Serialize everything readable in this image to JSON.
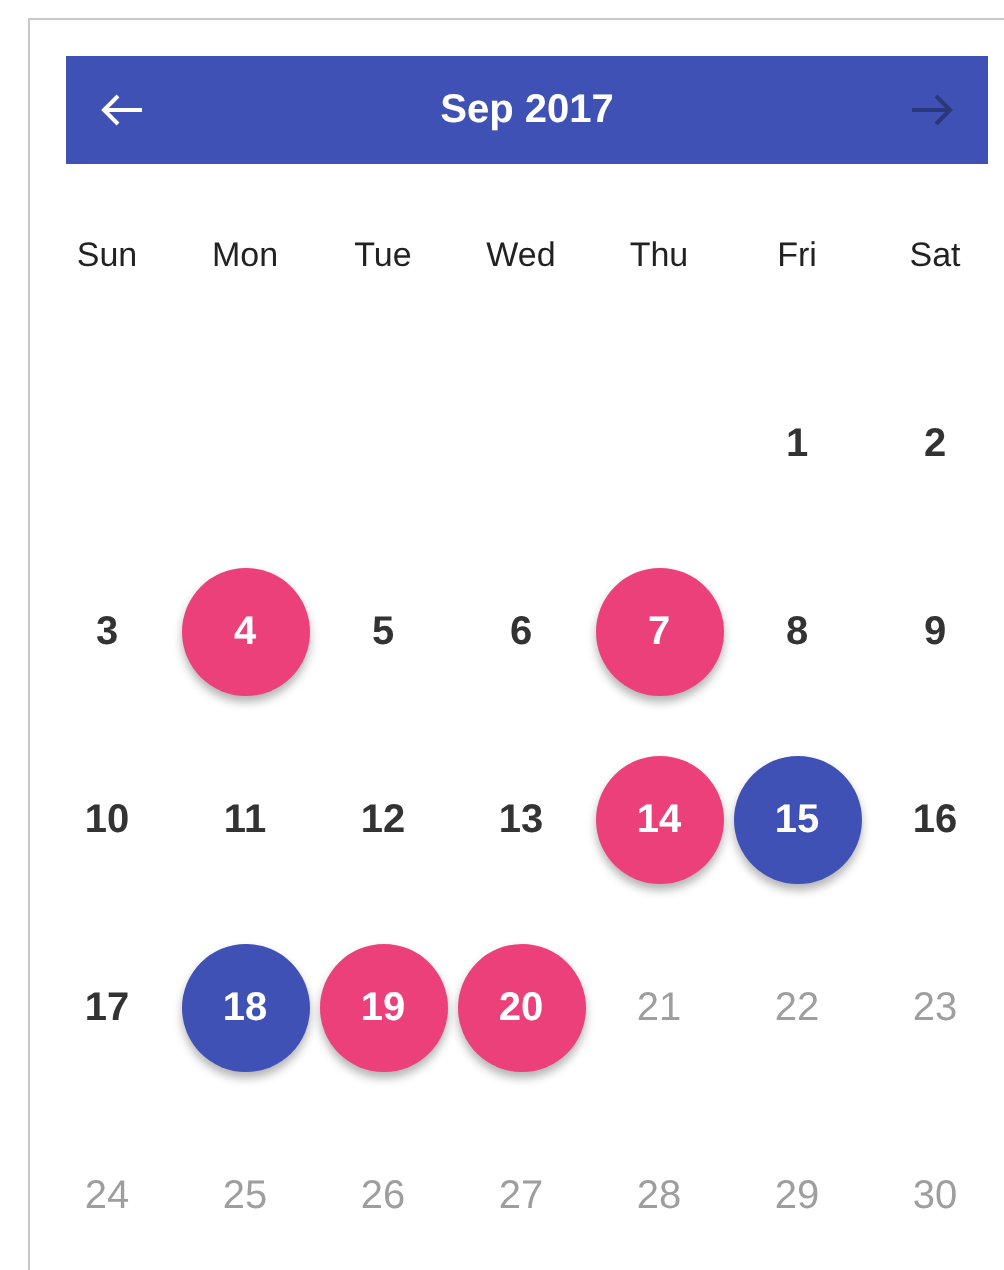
{
  "header": {
    "title": "Sep 2017",
    "prev": {
      "disabled": false
    },
    "next": {
      "disabled": true
    }
  },
  "weekdays": [
    "Sun",
    "Mon",
    "Tue",
    "Wed",
    "Thu",
    "Fri",
    "Sat"
  ],
  "weeks": [
    [
      {
        "label": "1",
        "disabled": false
      },
      {
        "label": "2",
        "disabled": false
      }
    ],
    [
      {
        "label": "3",
        "disabled": false
      },
      {
        "label": "4",
        "disabled": false,
        "color": "#ec407a"
      },
      {
        "label": "5",
        "disabled": false
      },
      {
        "label": "6",
        "disabled": false
      },
      {
        "label": "7",
        "disabled": false,
        "color": "#ec407a"
      },
      {
        "label": "8",
        "disabled": false
      },
      {
        "label": "9",
        "disabled": false
      }
    ],
    [
      {
        "label": "10",
        "disabled": false
      },
      {
        "label": "11",
        "disabled": false
      },
      {
        "label": "12",
        "disabled": false
      },
      {
        "label": "13",
        "disabled": false
      },
      {
        "label": "14",
        "disabled": false,
        "color": "#ec407a"
      },
      {
        "label": "15",
        "disabled": false,
        "color": "#3f51b5"
      },
      {
        "label": "16",
        "disabled": false
      }
    ],
    [
      {
        "label": "17",
        "disabled": false
      },
      {
        "label": "18",
        "disabled": false,
        "color": "#3f51b5"
      },
      {
        "label": "19",
        "disabled": false,
        "color": "#ec407a"
      },
      {
        "label": "20",
        "disabled": false,
        "color": "#ec407a"
      },
      {
        "label": "21",
        "disabled": true
      },
      {
        "label": "22",
        "disabled": true
      },
      {
        "label": "23",
        "disabled": true
      }
    ],
    [
      {
        "label": "24",
        "disabled": true
      },
      {
        "label": "25",
        "disabled": true
      },
      {
        "label": "26",
        "disabled": true
      },
      {
        "label": "27",
        "disabled": true
      },
      {
        "label": "28",
        "disabled": true
      },
      {
        "label": "29",
        "disabled": true
      },
      {
        "label": "30",
        "disabled": true
      }
    ]
  ]
}
